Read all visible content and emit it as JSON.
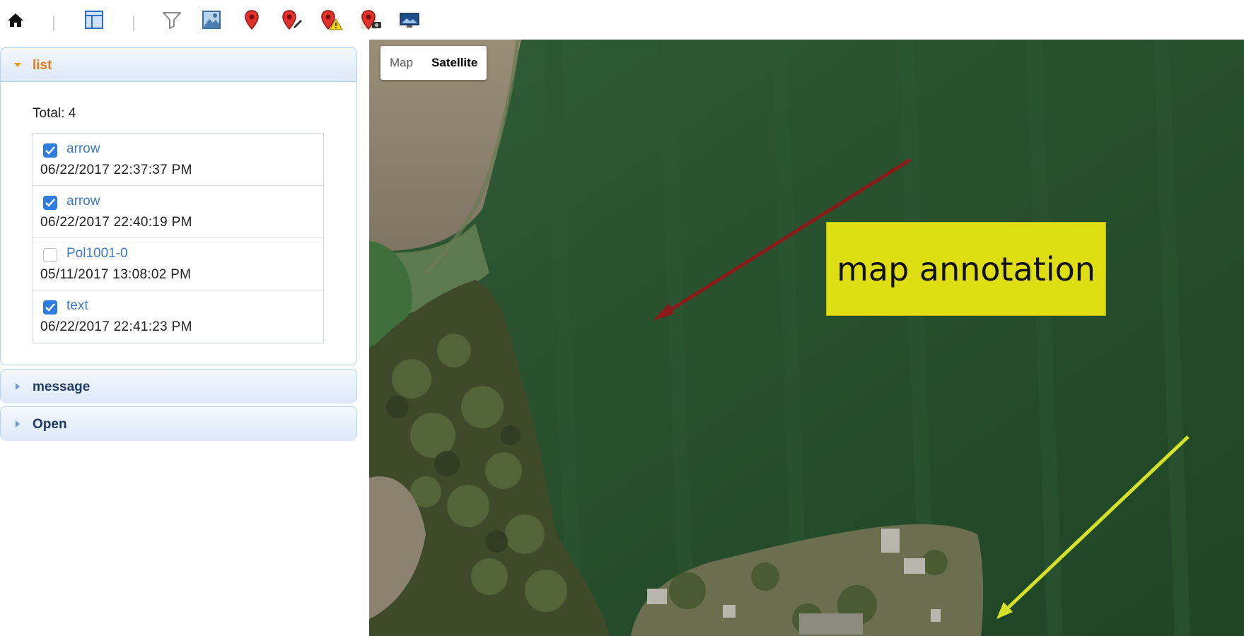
{
  "toolbar": {
    "icons": [
      "home-icon",
      "layout-panel-icon",
      "filter-icon",
      "map-image-icon",
      "map-pin-icon",
      "pin-edit-icon",
      "pin-warning-icon",
      "pin-camera-icon",
      "screen-icon"
    ]
  },
  "sidebar": {
    "list_panel": {
      "title": "list",
      "total_label": "Total: 4",
      "items": [
        {
          "name": "arrow",
          "date": "06/22/2017 22:37:37 PM",
          "checked": true
        },
        {
          "name": "arrow",
          "date": "06/22/2017 22:40:19 PM",
          "checked": true
        },
        {
          "name": "Pol1001-0",
          "date": "05/11/2017 13:08:02 PM",
          "checked": false
        },
        {
          "name": "text",
          "date": "06/22/2017 22:41:23 PM",
          "checked": true
        }
      ]
    },
    "message_panel": {
      "title": "message"
    },
    "open_panel": {
      "title": "Open"
    }
  },
  "map": {
    "type_controls": {
      "map_label": "Map",
      "satellite_label": "Satellite"
    },
    "annotation_text": "map annotation",
    "colors": {
      "annotation_box": "#dede12",
      "red_arrow": "#8b1a1a",
      "yellow_arrow": "#d6e12a",
      "accent_orange": "#e07b1a",
      "checkbox_blue": "#2f7de1"
    }
  }
}
